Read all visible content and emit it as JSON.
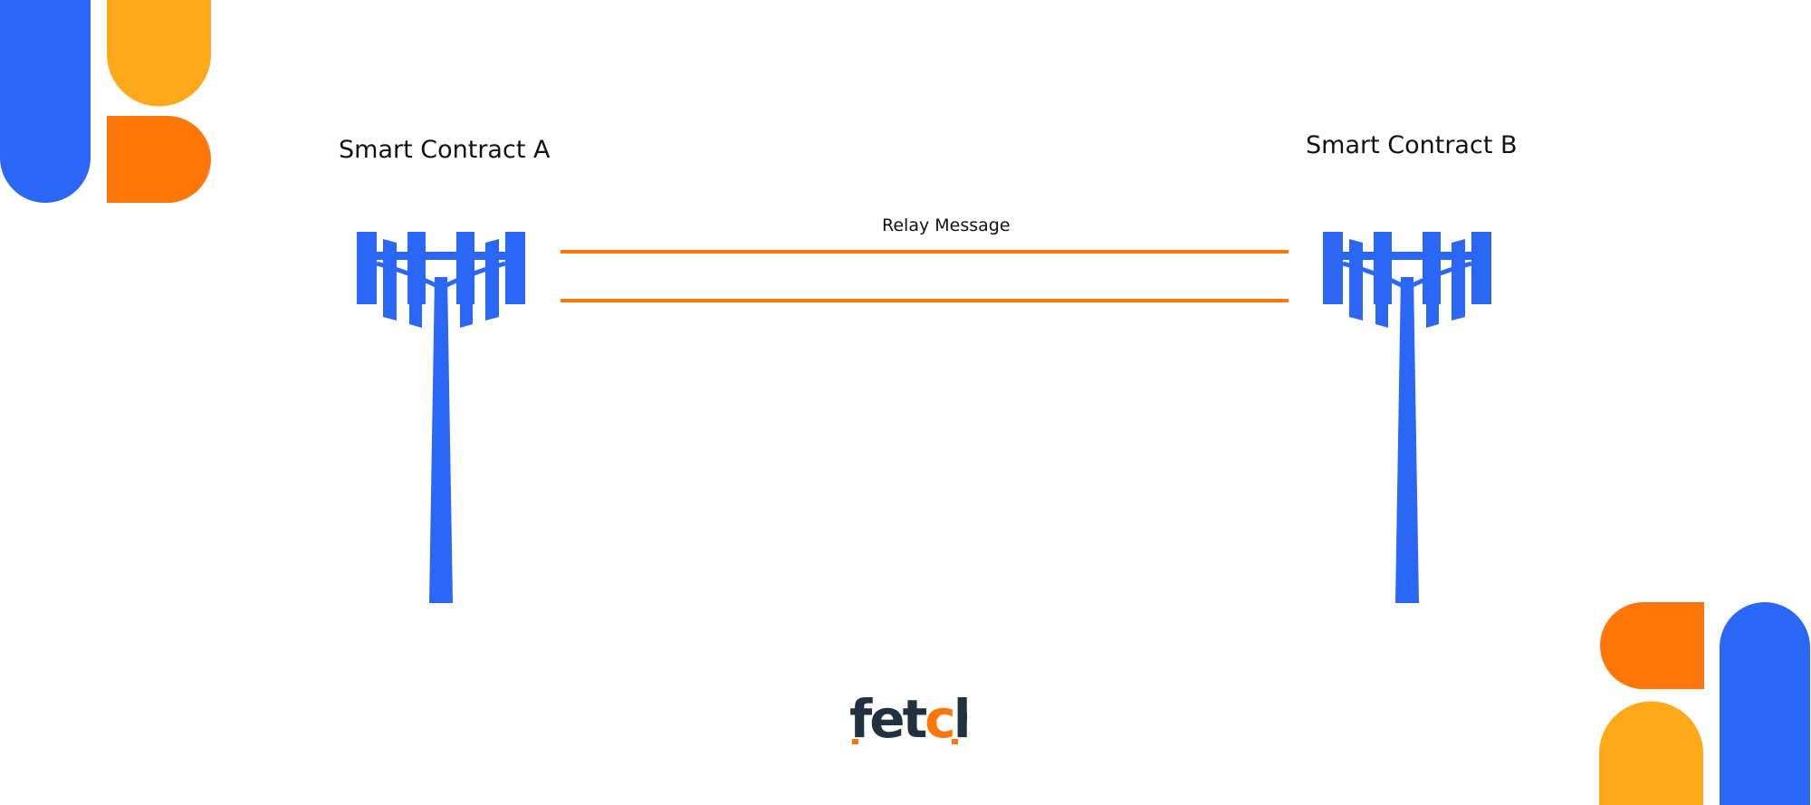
{
  "colors": {
    "blue": "#2B67F6",
    "yellow": "#FFA819",
    "orange": "#FF7708",
    "dark": "#22313F",
    "text": "#111111"
  },
  "nodes": [
    {
      "label": "Smart Contract A",
      "icon": "cell-tower-icon"
    },
    {
      "label": "Smart Contract B",
      "icon": "cell-tower-icon"
    }
  ],
  "connection": {
    "label": "Relay Message",
    "style": "double-line"
  },
  "logo": {
    "text": "fetch",
    "icon": "fetch-logo-icon"
  }
}
